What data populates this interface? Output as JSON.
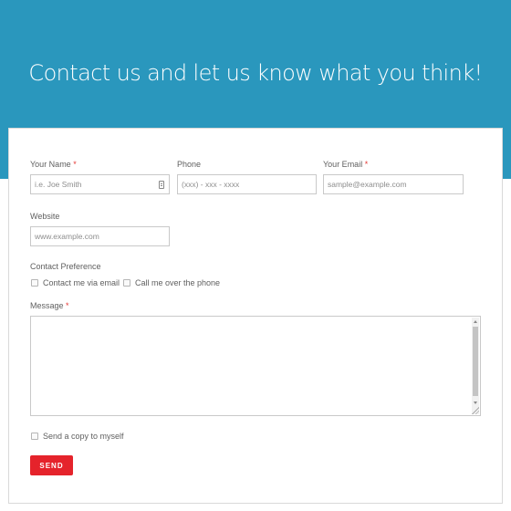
{
  "header": {
    "title": "Contact us and let us know what you think!"
  },
  "form": {
    "name": {
      "label": "Your Name",
      "required_mark": "*",
      "placeholder": "i.e. Joe Smith",
      "icon": "contact-card-icon"
    },
    "phone": {
      "label": "Phone",
      "placeholder": "(xxx) - xxx - xxxx"
    },
    "email": {
      "label": "Your Email",
      "required_mark": "*",
      "placeholder": "sample@example.com"
    },
    "website": {
      "label": "Website",
      "placeholder": "www.example.com"
    },
    "contact_preference": {
      "label": "Contact Preference",
      "options": [
        "Contact me via email",
        "Call me over the phone"
      ]
    },
    "message": {
      "label": "Message",
      "required_mark": "*"
    },
    "copy_label": "Send a copy to myself",
    "send_label": "SEND"
  },
  "colors": {
    "banner": "#2a97bd",
    "accent_button": "#e5232b",
    "required": "#e53935"
  }
}
